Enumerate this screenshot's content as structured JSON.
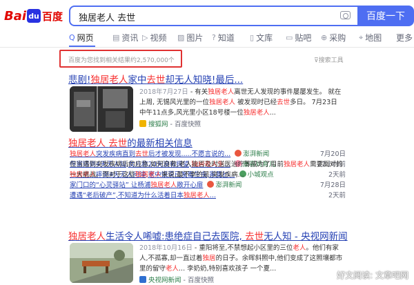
{
  "logo": {
    "text_bai": "Bai",
    "text_paw": "du",
    "text_cn": "百度"
  },
  "search": {
    "query": "独居老人 去世",
    "button": "百度一下"
  },
  "tabs": [
    {
      "icon": "search-icon",
      "glyph": "Q",
      "label": "网页"
    },
    {
      "icon": "news-icon",
      "glyph": "▤",
      "label": "资讯"
    },
    {
      "icon": "video-icon",
      "glyph": "▷",
      "label": "视频"
    },
    {
      "icon": "image-icon",
      "glyph": "▨",
      "label": "图片"
    },
    {
      "icon": "zhidao-icon",
      "glyph": "?",
      "label": "知道"
    },
    {
      "icon": "wenku-icon",
      "glyph": "▯",
      "label": "文库"
    },
    {
      "icon": "tieba-icon",
      "glyph": "▭",
      "label": "贴吧"
    },
    {
      "icon": "caigou-icon",
      "glyph": "⊕",
      "label": "采购"
    },
    {
      "icon": "map-icon",
      "glyph": "⌖",
      "label": "地图"
    },
    {
      "icon": "more-icon",
      "glyph": "",
      "label": "更多"
    }
  ],
  "stats": "百度为您找到相关结果约2,570,000个",
  "tools": "搜索工具",
  "result1": {
    "title": [
      {
        "t": "悲剧!",
        "hl": false
      },
      {
        "t": "独居老人",
        "hl": true
      },
      {
        "t": "家中",
        "hl": false
      },
      {
        "t": "去世",
        "hl": true
      },
      {
        "t": "却无人知晓!最后...",
        "hl": false
      }
    ],
    "date": "2018年7月27日",
    "snippet": [
      {
        "t": " - 有关",
        "hl": false
      },
      {
        "t": "独居老人",
        "hl": true
      },
      {
        "t": "离世无人发现的事件屡屡发生。 就在上周, 无锡风光里的一位",
        "hl": false
      },
      {
        "t": "独居老人",
        "hl": true
      },
      {
        "t": " 被发现时已经",
        "hl": false
      },
      {
        "t": "去世",
        "hl": true
      },
      {
        "t": "多日。 7月23日中午11点多,风光里小区18号楼一位",
        "hl": false
      },
      {
        "t": "独居老人",
        "hl": true
      },
      {
        "t": "...",
        "hl": false
      }
    ],
    "source": "搜狐网",
    "cache": "- 百度快照"
  },
  "result2": {
    "title": [
      {
        "t": "独居老人",
        "hl": true
      },
      {
        "t": " ",
        "hl": false
      },
      {
        "t": "去世",
        "hl": true
      },
      {
        "t": "的最新相关信息",
        "hl": false
      }
    ],
    "news": [
      {
        "parts": [
          {
            "t": "独居老人",
            "hl": true
          },
          {
            "t": "突发疾病直到",
            "hl": false
          },
          {
            "t": "去世",
            "hl": true
          },
          {
            "t": "后才被发现.....不愿言说的...",
            "hl": false
          }
        ],
        "source": "澎湃新闻",
        "time": "7月20日"
      },
      {
        "parts": [
          {
            "t": "在家摔倒4天无人知,女儿称20天没有探望,",
            "hl": false
          },
          {
            "t": "独居老人生",
            "hl": true
          },
          {
            "t": "...",
            "hl": false
          }
        ],
        "source": "康喜妈育儿",
        "time": "22小时前"
      },
      {
        "parts": [
          {
            "t": "独居老人",
            "hl": true
          },
          {
            "t": "摔倒4天无人问津,家中饭菜已发霉生虫,家属匕...",
            "hl": false
          }
        ],
        "source": "小城观点",
        "time": "2天前"
      },
      {
        "parts": [
          {
            "t": "家门口的“心灵驿站” 让杨浦",
            "hl": false
          },
          {
            "t": "独居老人",
            "hl": true
          },
          {
            "t": "敞开心扉",
            "hl": false
          }
        ],
        "source": "澎湃新闻",
        "time": "7月28日"
      },
      {
        "parts": [
          {
            "t": "遭遇“老后破产”,不知道为什么",
            "hl": false
          },
          {
            "t": "活着",
            "hl": false
          },
          {
            "t": "日本",
            "hl": false
          },
          {
            "t": "独居老人",
            "hl": true
          },
          {
            "t": "...",
            "hl": false
          }
        ],
        "source": "",
        "time": "2天前"
      }
    ],
    "snippet": [
      {
        "t": "但当遇到突发疾病后的应急,如何自救,老人能否及时送医治疗等成为了目前",
        "hl": false
      },
      {
        "t": "独居老人",
        "hl": true
      },
      {
        "t": "需要面对的一大挑战。而对于这些",
        "hl": false
      },
      {
        "t": "独居老人",
        "hl": true
      },
      {
        "t": "来说,最不幸的是,突发疾病...",
        "hl": false
      }
    ]
  },
  "result3": {
    "title": [
      {
        "t": "独居老人",
        "hl": true
      },
      {
        "t": "生活令人唏嘘:患绝症自己去医院, ",
        "hl": false
      },
      {
        "t": "去世",
        "hl": true
      },
      {
        "t": "无人知 - 央视网新闻",
        "hl": false
      }
    ],
    "date": "2018年10月16日",
    "snippet": [
      {
        "t": " - 重阳将至,不禁想起小区里的三位",
        "hl": false
      },
      {
        "t": "老人",
        "hl": true
      },
      {
        "t": "。他们有家人,不孤寡,却一直过着",
        "hl": false
      },
      {
        "t": "独居",
        "hl": true
      },
      {
        "t": "的日子。余晖斜照中,他们变成了这照壤都市里的留守",
        "hl": false
      },
      {
        "t": "老人",
        "hl": true
      },
      {
        "t": "... 李奶奶,特别喜欢孩子 一个夏...",
        "hl": false
      }
    ],
    "source": "央视网新闻",
    "cache": "- 百度快照"
  },
  "watermark": "好文阅读: 文章吧网",
  "colors": {
    "accent": "#4e6ef2",
    "link": "#2440b3",
    "highlight": "#f73131",
    "annotation": "#e03131"
  }
}
